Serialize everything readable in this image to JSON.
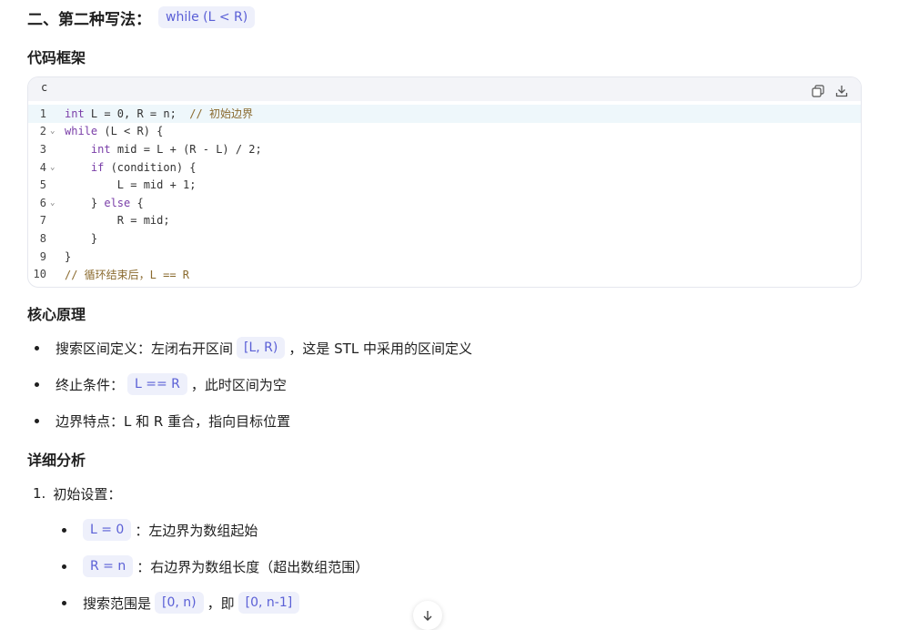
{
  "heading": {
    "title": "二、第二种写法：",
    "code": "while (L < R)"
  },
  "framework_title": "代码框架",
  "code": {
    "lang": "c",
    "lines": [
      {
        "n": "1",
        "fold": false,
        "parts": [
          [
            "kw",
            "int"
          ],
          [
            "t",
            " L = 0, R = n;  "
          ],
          [
            "cm",
            "// 初始边界"
          ]
        ]
      },
      {
        "n": "2",
        "fold": true,
        "parts": [
          [
            "kw",
            "while"
          ],
          [
            "t",
            " (L < R) {"
          ]
        ]
      },
      {
        "n": "3",
        "fold": false,
        "parts": [
          [
            "t",
            "    "
          ],
          [
            "kw",
            "int"
          ],
          [
            "t",
            " mid = L + (R - L) / 2;"
          ]
        ]
      },
      {
        "n": "4",
        "fold": true,
        "parts": [
          [
            "t",
            "    "
          ],
          [
            "kw",
            "if"
          ],
          [
            "t",
            " (condition) {"
          ]
        ]
      },
      {
        "n": "5",
        "fold": false,
        "parts": [
          [
            "t",
            "        L = mid + 1;"
          ]
        ]
      },
      {
        "n": "6",
        "fold": true,
        "parts": [
          [
            "t",
            "    } "
          ],
          [
            "kw",
            "else"
          ],
          [
            "t",
            " {"
          ]
        ]
      },
      {
        "n": "7",
        "fold": false,
        "parts": [
          [
            "t",
            "        R = mid;"
          ]
        ]
      },
      {
        "n": "8",
        "fold": false,
        "parts": [
          [
            "t",
            "    }"
          ]
        ]
      },
      {
        "n": "9",
        "fold": false,
        "parts": [
          [
            "t",
            "}"
          ]
        ]
      },
      {
        "n": "10",
        "fold": false,
        "parts": [
          [
            "cm",
            "// 循环结束后，L == R"
          ]
        ]
      }
    ]
  },
  "principle_title": "核心原理",
  "principle": [
    {
      "pre": "搜索区间定义：左闭右开区间 ",
      "code": "[L, R)",
      "post": "，这是 STL 中采用的区间定义"
    },
    {
      "pre": "终止条件： ",
      "code": "L == R",
      "post": "，此时区间为空"
    },
    {
      "pre": "边界特点：L 和 R 重合，指向目标位置",
      "code": "",
      "post": ""
    }
  ],
  "analysis_title": "详细分析",
  "analysis": {
    "num": "1.",
    "label": "初始设置：",
    "items": [
      {
        "code": "L = 0",
        "post": "：左边界为数组起始"
      },
      {
        "code": "R = n",
        "post": "：右边界为数组长度（超出数组范围）"
      },
      {
        "pre": "搜索范围是 ",
        "code": "[0, n)",
        "mid": "，即 ",
        "code2": "[0, n-1]"
      }
    ]
  }
}
